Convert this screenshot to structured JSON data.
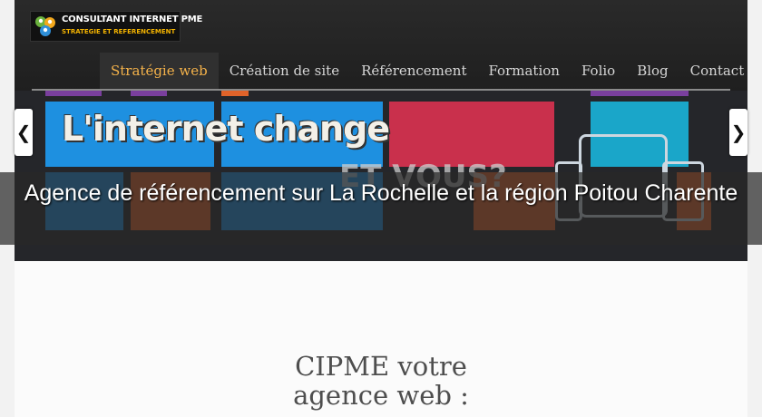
{
  "logo": {
    "title": "CONSULTANT INTERNET PME",
    "subtitle": "STRATEGIE ET REFERENCEMENT",
    "icon": "people-network-icon"
  },
  "nav": {
    "items": [
      {
        "label": "Stratégie web",
        "active": true
      },
      {
        "label": "Création de site",
        "active": false
      },
      {
        "label": "Référencement",
        "active": false
      },
      {
        "label": "Formation",
        "active": false
      },
      {
        "label": "Folio",
        "active": false
      },
      {
        "label": "Blog",
        "active": false
      },
      {
        "label": "Contact",
        "active": false
      }
    ],
    "active_color": "#f4b24a"
  },
  "banner": {
    "headline": "L'internet change",
    "subheadline": "ET VOUS?",
    "caption": "Agence de référencement sur La Rochelle et la région Poitou Charente",
    "prev_icon": "chevron-left-icon",
    "next_icon": "chevron-right-icon",
    "tile_colors": [
      "#1e90e0",
      "#c9304c",
      "#e0632a",
      "#7a3f9e",
      "#1aa6c9"
    ]
  },
  "main": {
    "heading": "CIPME votre agence web :"
  }
}
